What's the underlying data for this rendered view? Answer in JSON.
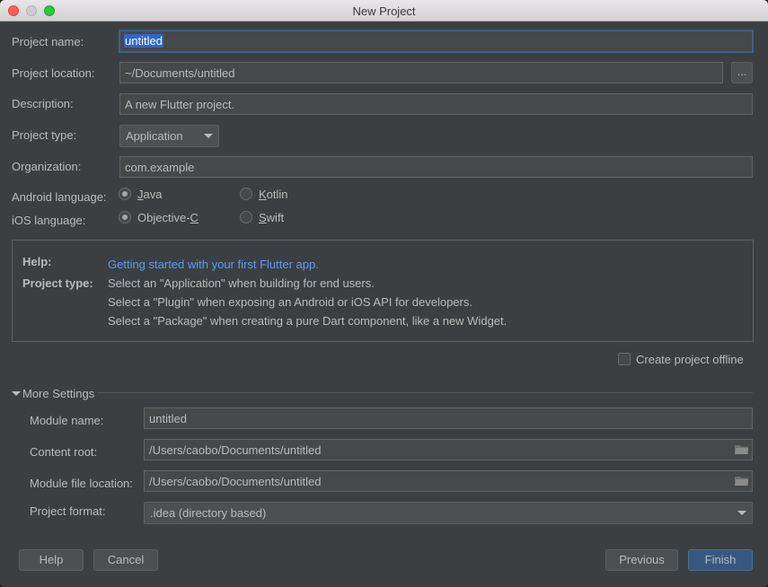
{
  "window": {
    "title": "New Project"
  },
  "form": {
    "project_name_label": "Project name:",
    "project_name_value": "untitled",
    "project_location_label": "Project location:",
    "project_location_value": "~/Documents/untitled",
    "browse_label": "...",
    "description_label": "Description:",
    "description_value": "A new Flutter project.",
    "project_type_label": "Project type:",
    "project_type_value": "Application",
    "organization_label": "Organization:",
    "organization_value": "com.example",
    "android_language_label": "Android language:",
    "android_options": [
      {
        "prefix": "",
        "mnemonic": "J",
        "suffix": "ava",
        "selected": true
      },
      {
        "prefix": "",
        "mnemonic": "K",
        "suffix": "otlin",
        "selected": false
      }
    ],
    "ios_language_label": "iOS language:",
    "ios_options": [
      {
        "prefix": "Objective-",
        "mnemonic": "C",
        "suffix": "",
        "selected": true
      },
      {
        "prefix": "",
        "mnemonic": "S",
        "suffix": "wift",
        "selected": false
      }
    ]
  },
  "help": {
    "help_label": "Help:",
    "help_link": "Getting started with your first Flutter app.",
    "type_label": "Project type:",
    "lines": [
      "Select an \"Application\" when building for end users.",
      "Select a \"Plugin\" when exposing an Android or iOS API for developers.",
      "Select a \"Package\" when creating a pure Dart component, like a new Widget."
    ]
  },
  "offline": {
    "label": "Create project offline",
    "checked": false
  },
  "more_settings": {
    "title": "More Settings",
    "module_name_label": "Module name:",
    "module_name_value": "untitled",
    "content_root_label": "Content root:",
    "content_root_value": "/Users/caobo/Documents/untitled",
    "module_file_label": "Module file location:",
    "module_file_value": "/Users/caobo/Documents/untitled",
    "project_format_label": "Project format:",
    "project_format_value": ".idea (directory based)"
  },
  "buttons": {
    "help": "Help",
    "cancel": "Cancel",
    "previous": "Previous",
    "finish": "Finish"
  },
  "colors": {
    "background": "#3c3f41",
    "link": "#589df6",
    "default_button": "#365880",
    "selection": "#2f65ca"
  }
}
